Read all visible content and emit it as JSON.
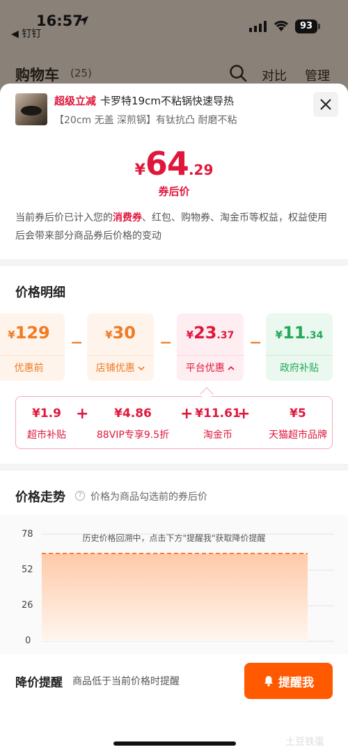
{
  "status_bar": {
    "time": "16:57",
    "back_app": "◀ 钉钉",
    "battery": "93"
  },
  "cart_header": {
    "title": "购物车",
    "count": "(25)",
    "compare": "对比",
    "manage": "管理"
  },
  "product": {
    "tag": "超级立减",
    "name": "卡罗特19cm不粘锅快速导热",
    "spec": "【20cm 无盖 深煎锅】有钛抗凸 耐磨不粘"
  },
  "price": {
    "yen": "¥",
    "integer": "64",
    "decimal": ".29",
    "label": "券后价",
    "note_pre": "当前券后价已计入您的",
    "note_hl": "消费券",
    "note_post": "、红包、购物券、淘金币等权益，权益使用后会带来部分商品券后价格的变动"
  },
  "detail": {
    "title": "价格明细",
    "cards": [
      {
        "yen": "¥",
        "int": "129",
        "dec": "",
        "label": "优惠前"
      },
      {
        "yen": "¥",
        "int": "30",
        "dec": "",
        "label": "店铺优惠"
      },
      {
        "yen": "¥",
        "int": "23",
        "dec": ".37",
        "label": "平台优惠"
      },
      {
        "yen": "¥",
        "int": "11",
        "dec": ".34",
        "label": "政府补贴"
      }
    ],
    "operator": "−",
    "subsidies": [
      {
        "value": "¥1.9",
        "label": "超市补贴"
      },
      {
        "value": "¥4.86",
        "label": "88VIP专享9.5折"
      },
      {
        "value": "¥11.61",
        "label": "淘金币"
      },
      {
        "value": "¥5",
        "label": "天猫超市品牌"
      }
    ],
    "plus": "+"
  },
  "trend": {
    "title": "价格走势",
    "desc": "价格为商品勾选前的券后价",
    "note": "历史价格回溯中，点击下方\"提醒我\"获取降价提醒",
    "y_ticks": [
      "78",
      "52",
      "26",
      "0"
    ]
  },
  "alert": {
    "title": "降价提醒",
    "desc": "商品低于当前价格时提醒",
    "button": "提醒我"
  },
  "watermark": "土豆铁蛋",
  "colors": {
    "brand_red": "#e0173c",
    "orange": "#ff5a00",
    "green": "#22a95a"
  }
}
